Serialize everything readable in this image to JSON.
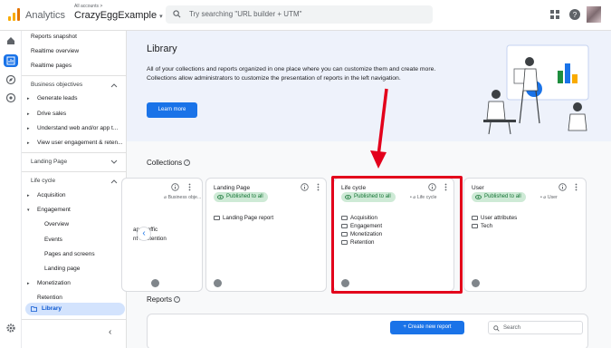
{
  "header": {
    "app_name": "Analytics",
    "account_crumb": "All accounts >",
    "property_name": "CrazyEggExample",
    "search_placeholder": "Try searching \"URL builder + UTM\""
  },
  "nav": {
    "items": [
      {
        "label": "Reports snapshot"
      },
      {
        "label": "Realtime overview"
      },
      {
        "label": "Realtime pages"
      }
    ],
    "business_objectives": {
      "title": "Business objectives",
      "items": [
        "Generate leads",
        "Drive sales",
        "Understand web and/or app t...",
        "View user engagement & reten..."
      ]
    },
    "landing_page": {
      "title": "Landing Page"
    },
    "life_cycle": {
      "title": "Life cycle",
      "items": [
        "Acquisition",
        "Engagement"
      ],
      "engagement_children": [
        "Overview",
        "Events",
        "Pages and screens",
        "Landing page"
      ],
      "more_items": [
        "Monetization",
        "Retention"
      ]
    },
    "library": "Library"
  },
  "library": {
    "title": "Library",
    "description": "All of your collections and reports organized in one place where you can customize them and create more. Collections allow administrators to customize the presentation of reports in the left navigation.",
    "learn_more": "Learn more"
  },
  "collections": {
    "title": "Collections",
    "cards": [
      {
        "name": "",
        "tag": "Business obje...",
        "rows": [
          "app traffic",
          "nt & retention"
        ]
      },
      {
        "name": "Landing Page",
        "status": "Published to all",
        "rows": [
          "Landing Page report"
        ]
      },
      {
        "name": "Life cycle",
        "status": "Published to all",
        "tag": "Life cycle",
        "rows": [
          "Acquisition",
          "Engagement",
          "Monetization",
          "Retention"
        ]
      },
      {
        "name": "User",
        "status": "Published to all",
        "tag": "User",
        "rows": [
          "User attributes",
          "Tech"
        ]
      }
    ]
  },
  "reports": {
    "title": "Reports",
    "create_button": "Create new report",
    "search_placeholder": "Search"
  },
  "colors": {
    "accent": "#1a73e8",
    "highlight": "#e3001b",
    "published_bg": "#ceead6",
    "published_text": "#137333"
  }
}
